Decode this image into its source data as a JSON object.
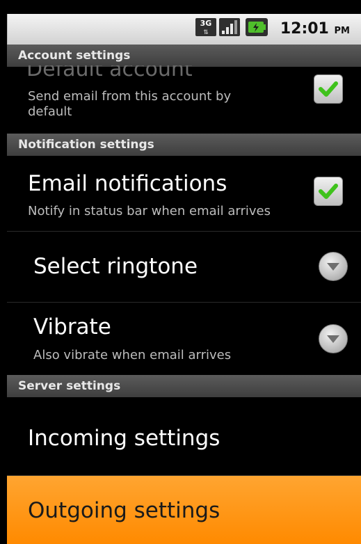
{
  "status_bar": {
    "network_label": "3G",
    "time": "12:01",
    "ampm": "PM",
    "icons": [
      "3g-data-icon",
      "signal-strength-icon",
      "battery-charging-icon"
    ]
  },
  "sections": {
    "account_settings": "Account settings",
    "notification_settings": "Notification settings",
    "server_settings": "Server settings"
  },
  "items": {
    "default_account": {
      "title": "Default account",
      "summary": "Send email from this account by default",
      "summary_line1": "Send email from this account by",
      "summary_line2": "default",
      "checked": true
    },
    "email_notifications": {
      "title": "Email notifications",
      "summary": "Notify in status bar when email arrives",
      "checked": true
    },
    "select_ringtone": {
      "title": "Select ringtone"
    },
    "vibrate": {
      "title": "Vibrate",
      "summary": "Also vibrate when email arrives"
    },
    "incoming_settings": {
      "title": "Incoming settings"
    },
    "outgoing_settings": {
      "title": "Outgoing settings",
      "selected": true
    }
  },
  "colors": {
    "highlight": "#ff9a1a",
    "check_mark": "#3fc21c",
    "section_header": "#4a4a4a"
  }
}
